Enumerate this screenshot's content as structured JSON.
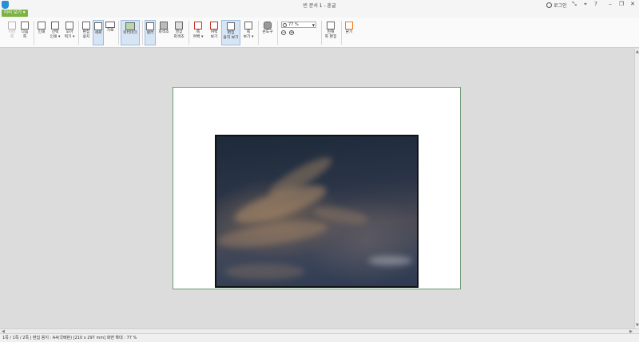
{
  "window": {
    "title": "빈 문서 1 - 훈글",
    "login_label": "로그인",
    "controls": [
      "⤡",
      "⌖",
      "?",
      "–",
      "❐",
      "✕"
    ]
  },
  "tabs": {
    "active": "미리 보기 ▾"
  },
  "toolbar": {
    "buttons": [
      {
        "label": "이전\n쪽"
      },
      {
        "label": "다음\n쪽"
      },
      {
        "label": "인쇄"
      },
      {
        "label": "선택\n인쇄 ▾"
      },
      {
        "label": "모아\n찍기 ▾"
      },
      {
        "label": "편집\n용지"
      },
      {
        "label": "세로"
      },
      {
        "label": "가로"
      },
      {
        "label": "워터마크"
      },
      {
        "label": "컬러"
      },
      {
        "label": "회색조"
      },
      {
        "label": "영상\n회색조"
      },
      {
        "label": "쪽\n여백 ▾"
      },
      {
        "label": "여백\n보기"
      },
      {
        "label": "편집\n용지 보기"
      },
      {
        "label": "쪽\n보기 ▾"
      },
      {
        "label": "손도구"
      },
      {
        "label": "현재\n쪽 편집"
      },
      {
        "label": "닫기"
      }
    ],
    "zoom_value": "77 %",
    "zoom_in_icon": "+",
    "zoom_out_icon": "−"
  },
  "status": {
    "text": "1쪽 / 1쪽 / 2쪽 | 편집 용지 : A4(국배판) [210 x 297 mm] 화면 확대 : 77 %"
  },
  "colors": {
    "accent": "#7cb342",
    "active_button": "#d6e4f3",
    "page_border": "#6f9e73"
  }
}
